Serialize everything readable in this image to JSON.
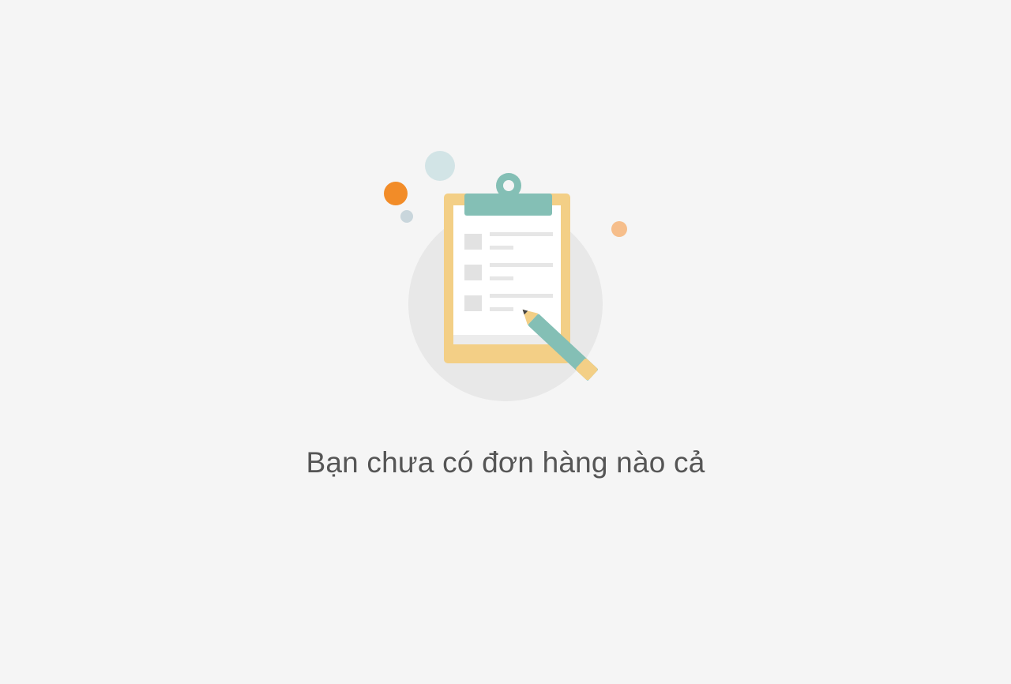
{
  "empty_state": {
    "icon": "clipboard-pencil-icon",
    "message": "Bạn chưa có đơn hàng nào cả"
  },
  "colors": {
    "background": "#f5f5f5",
    "text": "#555555",
    "accent_teal": "#84bfb5",
    "accent_orange": "#f28c28",
    "clipboard_frame": "#f3cf86"
  }
}
